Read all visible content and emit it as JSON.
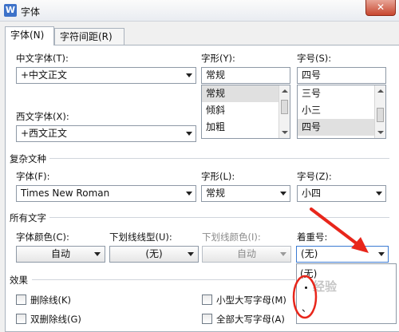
{
  "window": {
    "title": "字体",
    "app_icon_letter": "W"
  },
  "tabs": [
    {
      "label": "字体(N)",
      "active": true
    },
    {
      "label": "字符间距(R)",
      "active": false
    }
  ],
  "chinese_font": {
    "label": "中文字体(T):",
    "value": "+中文正文"
  },
  "font_style": {
    "label": "字形(Y):",
    "value": "常规",
    "options": [
      "常规",
      "倾斜",
      "加粗"
    ],
    "selected_index": 0
  },
  "font_size": {
    "label": "字号(S):",
    "value": "四号",
    "options": [
      "三号",
      "小三",
      "四号"
    ],
    "selected_index": 2
  },
  "western_font": {
    "label": "西文字体(X):",
    "value": "+西文正文"
  },
  "complex_script": {
    "title": "复杂文种",
    "font_label": "字体(F):",
    "font_value": "Times New Roman",
    "style_label": "字形(L):",
    "style_value": "常规",
    "size_label": "字号(Z):",
    "size_value": "小四"
  },
  "all_text": {
    "title": "所有文字",
    "color_label": "字体颜色(C):",
    "color_value": "自动",
    "underline_type_label": "下划线线型(U):",
    "underline_type_value": "(无)",
    "underline_color_label": "下划线颜色(I):",
    "underline_color_value": "自动",
    "emphasis_label": "着重号:",
    "emphasis_value": "(无)",
    "emphasis_options": [
      "(无)",
      "·",
      "、"
    ]
  },
  "effects": {
    "title": "效果",
    "items_left": [
      "删除线(K)",
      "双删除线(G)"
    ],
    "items_right": [
      "小型大写字母(M)",
      "全部大写字母(A)"
    ]
  },
  "annotations": {
    "arrow_color": "#e8261b",
    "watermark": "经验"
  },
  "colors": {
    "close_button": "#c7472f",
    "accent": "#3b7bd3",
    "panel_border": "#a9b2bd"
  }
}
